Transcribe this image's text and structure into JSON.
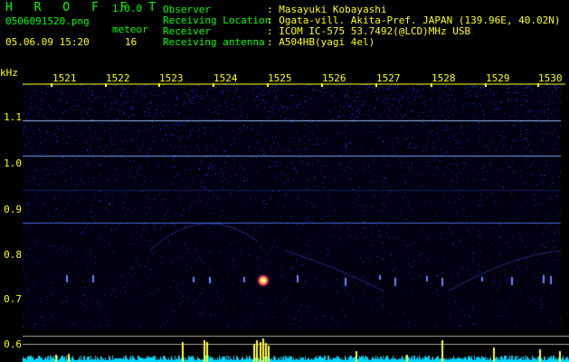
{
  "app": {
    "title": "H R O F F T",
    "version": "1.0.0"
  },
  "file": {
    "name": "0506091520.png",
    "datetime": "05.06.09 15:20",
    "mode_label": "meteor",
    "count": "16"
  },
  "info": {
    "labels": [
      "Observer",
      "Receiving Location",
      "Receiver",
      "Receiving antenna"
    ],
    "values": [
      ": Masayuki Kobayashi",
      ": Ogata-vill. Akita-Pref. JAPAN (139.96E, 40.02N)",
      ": ICOM IC-575 53.7492(@LCD)MHz USB",
      ": A504HB(yagi 4el)"
    ]
  },
  "axes": {
    "y_unit": "kHz",
    "y_ticks": [
      "1.1",
      "1.0",
      "0.9",
      "0.8",
      "0.7",
      "0.6"
    ],
    "x_ticks": [
      "1521",
      "1522",
      "1523",
      "1524",
      "1525",
      "1526",
      "1527",
      "1528",
      "1529",
      "1530"
    ]
  },
  "colors": {
    "label_green": "#00ff00",
    "text_yellow": "#ffff00",
    "noise_blue": "#2a35c8",
    "carrier": "#8ab4ff",
    "spectrum_cyan": "#00e0ff"
  }
}
